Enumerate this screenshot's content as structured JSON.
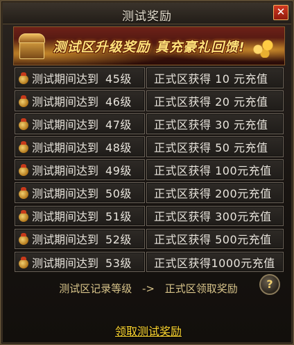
{
  "window": {
    "title": "测试奖励",
    "close_label": "✕"
  },
  "banner": {
    "text": "测试区升级奖励 真充豪礼回馈!"
  },
  "rows": [
    {
      "label": "测试期间达到",
      "level": "45级",
      "reward": "正式区获得 10 元充值"
    },
    {
      "label": "测试期间达到",
      "level": "46级",
      "reward": "正式区获得 20 元充值"
    },
    {
      "label": "测试期间达到",
      "level": "47级",
      "reward": "正式区获得 30 元充值"
    },
    {
      "label": "测试期间达到",
      "level": "48级",
      "reward": "正式区获得 50 元充值"
    },
    {
      "label": "测试期间达到",
      "level": "49级",
      "reward": "正式区获得 100元充值"
    },
    {
      "label": "测试期间达到",
      "level": "50级",
      "reward": "正式区获得 200元充值"
    },
    {
      "label": "测试期间达到",
      "level": "51级",
      "reward": "正式区获得 300元充值"
    },
    {
      "label": "测试期间达到",
      "level": "52级",
      "reward": "正式区获得 500元充值"
    },
    {
      "label": "测试期间达到",
      "level": "53级",
      "reward": "正式区获得1000元充值"
    }
  ],
  "footer": {
    "hint_left": "测试区记录等级",
    "hint_arrow": "->",
    "hint_right": "正式区领取奖励",
    "help_label": "?",
    "claim_label": "领取测试奖励"
  },
  "colors": {
    "accent_gold": "#ffd830",
    "close_red": "#c02a18",
    "banner_text": "#ffe27a"
  }
}
